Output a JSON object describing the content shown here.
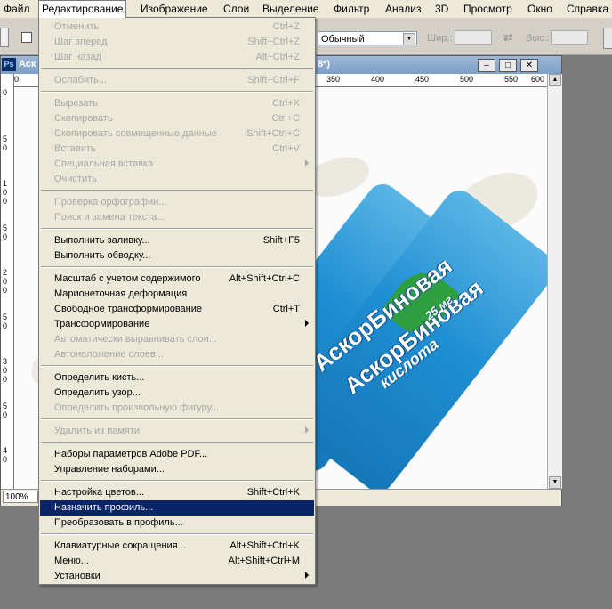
{
  "menubar": {
    "items": [
      "Файл",
      "Редактирование",
      "Изображение",
      "Слои",
      "Выделение",
      "Фильтр",
      "Анализ",
      "3D",
      "Просмотр",
      "Окно",
      "Справка"
    ]
  },
  "optbar": {
    "mode_value": "Обычный",
    "width_label": "Шир.:",
    "height_label": "Выс.:"
  },
  "document": {
    "title_left": "Аск",
    "title_right": "8*)",
    "zoom": "100%",
    "ruler_top": [
      "0",
      "350",
      "400",
      "450",
      "500",
      "550",
      "600"
    ],
    "ruler_left": [
      "0",
      "5",
      "0",
      "1",
      "0",
      "0",
      "5",
      "0",
      "2",
      "0",
      "0",
      "5",
      "0",
      "3",
      "0",
      "0",
      "5",
      "0",
      "4",
      "0"
    ],
    "product": {
      "brand": "АскорБиновая",
      "sub": "кислота",
      "dose": "25 мг"
    }
  },
  "menu": {
    "items": [
      {
        "label": "Отменить",
        "shortcut": "Ctrl+Z",
        "disabled": true
      },
      {
        "label": "Шаг вперед",
        "shortcut": "Shift+Ctrl+Z",
        "disabled": true
      },
      {
        "label": "Шаг назад",
        "shortcut": "Alt+Ctrl+Z",
        "disabled": true
      },
      {
        "label": "Ослабить...",
        "shortcut": "Shift+Ctrl+F",
        "disabled": true
      },
      {
        "label": "Вырезать",
        "shortcut": "Ctrl+X",
        "disabled": true
      },
      {
        "label": "Скопировать",
        "shortcut": "Ctrl+C",
        "disabled": true
      },
      {
        "label": "Скопировать совмещенные данные",
        "shortcut": "Shift+Ctrl+C",
        "disabled": true
      },
      {
        "label": "Вставить",
        "shortcut": "Ctrl+V",
        "disabled": true
      },
      {
        "label": "Специальная вставка",
        "shortcut": "",
        "disabled": true
      },
      {
        "label": "Очистить",
        "shortcut": "",
        "disabled": true
      },
      {
        "label": "Проверка орфографии...",
        "shortcut": "",
        "disabled": true
      },
      {
        "label": "Поиск и замена текста...",
        "shortcut": "",
        "disabled": true
      },
      {
        "label": "Выполнить заливку...",
        "shortcut": "Shift+F5",
        "disabled": false
      },
      {
        "label": "Выполнить обводку...",
        "shortcut": "",
        "disabled": false
      },
      {
        "label": "Масштаб с учетом содержимого",
        "shortcut": "Alt+Shift+Ctrl+C",
        "disabled": false
      },
      {
        "label": "Марионеточная деформация",
        "shortcut": "",
        "disabled": false
      },
      {
        "label": "Свободное трансформирование",
        "shortcut": "Ctrl+T",
        "disabled": false
      },
      {
        "label": "Трансформирование",
        "shortcut": "",
        "disabled": false
      },
      {
        "label": "Автоматически выравнивать слои...",
        "shortcut": "",
        "disabled": true
      },
      {
        "label": "Автоналожение слоев...",
        "shortcut": "",
        "disabled": true
      },
      {
        "label": "Определить кисть...",
        "shortcut": "",
        "disabled": false
      },
      {
        "label": "Определить узор...",
        "shortcut": "",
        "disabled": false
      },
      {
        "label": "Определить произвольную фигуру...",
        "shortcut": "",
        "disabled": true
      },
      {
        "label": "Удалить из памяти",
        "shortcut": "",
        "disabled": true
      },
      {
        "label": "Наборы параметров Adobe PDF...",
        "shortcut": "",
        "disabled": false
      },
      {
        "label": "Управление наборами...",
        "shortcut": "",
        "disabled": false
      },
      {
        "label": "Настройка цветов...",
        "shortcut": "Shift+Ctrl+K",
        "disabled": false
      },
      {
        "label": "Назначить профиль...",
        "shortcut": "",
        "disabled": false
      },
      {
        "label": "Преобразовать в профиль...",
        "shortcut": "",
        "disabled": false
      },
      {
        "label": "Клавиатурные сокращения...",
        "shortcut": "Alt+Shift+Ctrl+K",
        "disabled": false
      },
      {
        "label": "Меню...",
        "shortcut": "Alt+Shift+Ctrl+M",
        "disabled": false
      },
      {
        "label": "Установки",
        "shortcut": "",
        "disabled": false
      }
    ]
  }
}
